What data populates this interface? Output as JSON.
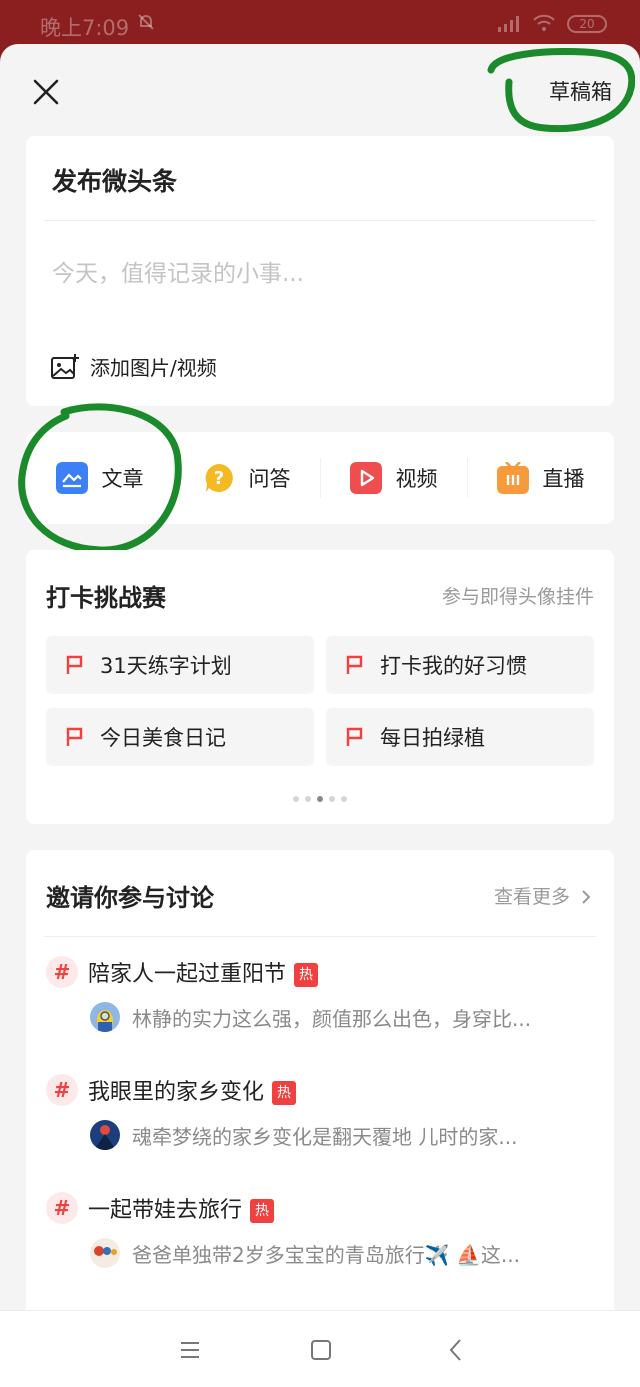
{
  "status_bar": {
    "time": "晚上7:09",
    "battery": "20"
  },
  "header": {
    "drafts_label": "草稿箱"
  },
  "publish": {
    "title": "发布微头条",
    "placeholder": "今天，值得记录的小事...",
    "add_media_label": "添加图片/视频"
  },
  "post_types": [
    {
      "label": "文章",
      "icon": "article-icon",
      "color": "#3d7ff5"
    },
    {
      "label": "问答",
      "icon": "question-icon",
      "color": "#f5b921"
    },
    {
      "label": "视频",
      "icon": "video-icon",
      "color": "#f04e4e"
    },
    {
      "label": "直播",
      "icon": "live-icon",
      "color": "#f79a3b"
    }
  ],
  "challenge": {
    "title": "打卡挑战赛",
    "subtitle": "参与即得头像挂件",
    "items": [
      "31天练字计划",
      "打卡我的好习惯",
      "今日美食日记",
      "每日拍绿植"
    ],
    "page_count": 5,
    "active_page": 3
  },
  "discussion": {
    "title": "邀请你参与讨论",
    "more_label": "查看更多",
    "hot_badge": "热",
    "topics": [
      {
        "name": "陪家人一起过重阳节",
        "excerpt": "林静的实力这么强，颜值那么出色，身穿比..."
      },
      {
        "name": "我眼里的家乡变化",
        "excerpt": "魂牵梦绕的家乡变化是翻天覆地  儿时的家..."
      },
      {
        "name": "一起带娃去旅行",
        "excerpt": "爸爸单独带2岁多宝宝的青岛旅行✈️ ⛵这..."
      }
    ]
  },
  "colors": {
    "annotation_ring": "#1a8a2a",
    "accent_red": "#f04141"
  }
}
